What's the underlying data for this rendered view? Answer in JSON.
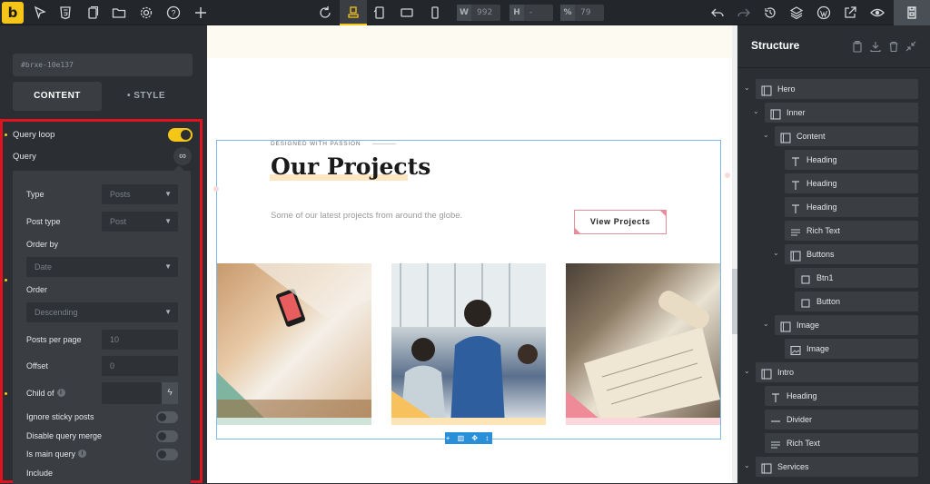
{
  "toolbar": {
    "logo": "b",
    "width_label": "W",
    "width_value": "992",
    "height_label": "H",
    "height_value": "-",
    "zoom_label": "%",
    "zoom_value": "79",
    "left_icons": [
      "cursor-icon",
      "html5-icon",
      "pages-icon",
      "folder-icon",
      "gear-icon",
      "help-icon",
      "plus-icon"
    ],
    "center_icons": [
      "refresh-icon",
      "desktop-breakpoint-icon",
      "tablet-landscape-icon",
      "tablet-portrait-icon",
      "mobile-icon"
    ],
    "right_icons": [
      "undo-icon",
      "redo-icon",
      "history-icon",
      "layers-icon",
      "wordpress-icon",
      "external-link-icon",
      "preview-eye-icon",
      "save-icon"
    ]
  },
  "left_panel": {
    "element_id": "#brxe-10e137",
    "tabs": [
      "CONTENT",
      "• STYLE"
    ],
    "query_loop_label": "Query loop",
    "query_label": "Query",
    "query_icon": "∞",
    "fields": {
      "type": {
        "label": "Type",
        "value": "Posts"
      },
      "post_type": {
        "label": "Post type",
        "value": "Post"
      },
      "order_by": {
        "label": "Order by",
        "value": "Date"
      },
      "order": {
        "label": "Order",
        "value": "Descending"
      },
      "posts_per_page": {
        "label": "Posts per page",
        "placeholder": "10"
      },
      "offset": {
        "label": "Offset",
        "placeholder": "0"
      },
      "child_of": {
        "label": "Child of"
      },
      "ignore_sticky": {
        "label": "Ignore sticky posts"
      },
      "disable_merge": {
        "label": "Disable query merge"
      },
      "is_main_query": {
        "label": "Is main query"
      },
      "include": {
        "label": "Include"
      }
    }
  },
  "canvas": {
    "eyebrow": "DESIGNED WITH PASSION",
    "title": "Our Projects",
    "text": "Some of our latest projects from around the globe.",
    "button": "View Projects",
    "colors": {
      "pink": "#e58d9b",
      "peach": "#fde7c2",
      "teal": "#7fb5a0",
      "yellow": "#f7c15e",
      "selection": "#2a8fd9"
    },
    "selection_toolbar": "+ ▥ ✥ ↕"
  },
  "structure": {
    "title": "Structure",
    "header_icons": [
      "clipboard-icon",
      "download-icon",
      "trash-icon",
      "collapse-icon"
    ],
    "items": [
      {
        "label": "Hero",
        "icon": "section-icon",
        "depth": 0,
        "caret": true
      },
      {
        "label": "Inner",
        "icon": "container-icon",
        "depth": 1,
        "caret": true
      },
      {
        "label": "Content",
        "icon": "container-icon",
        "depth": 2,
        "caret": true
      },
      {
        "label": "Heading",
        "icon": "heading-icon",
        "depth": 3,
        "caret": false
      },
      {
        "label": "Heading",
        "icon": "heading-icon",
        "depth": 3,
        "caret": false
      },
      {
        "label": "Heading",
        "icon": "heading-icon",
        "depth": 3,
        "caret": false
      },
      {
        "label": "Rich Text",
        "icon": "rich-text-icon",
        "depth": 3,
        "caret": false
      },
      {
        "label": "Buttons",
        "icon": "container-icon",
        "depth": 3,
        "caret": true
      },
      {
        "label": "Btn1",
        "icon": "block-icon",
        "depth": 4,
        "caret": false
      },
      {
        "label": "Button",
        "icon": "block-icon",
        "depth": 4,
        "caret": false
      },
      {
        "label": "Image",
        "icon": "container-icon",
        "depth": 2,
        "caret": true
      },
      {
        "label": "Image",
        "icon": "image-icon",
        "depth": 3,
        "caret": false
      },
      {
        "label": "Intro",
        "icon": "section-icon",
        "depth": 0,
        "caret": true
      },
      {
        "label": "Heading",
        "icon": "heading-icon",
        "depth": 1,
        "caret": false
      },
      {
        "label": "Divider",
        "icon": "divider-icon",
        "depth": 1,
        "caret": false
      },
      {
        "label": "Rich Text",
        "icon": "rich-text-icon",
        "depth": 1,
        "caret": false
      },
      {
        "label": "Services",
        "icon": "section-icon",
        "depth": 0,
        "caret": true
      }
    ]
  }
}
